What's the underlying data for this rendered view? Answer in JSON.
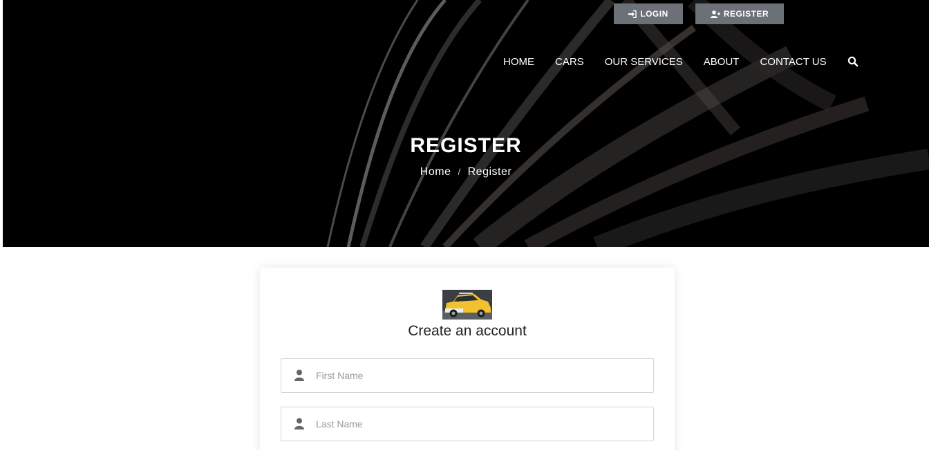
{
  "header": {
    "login_label": "LOGIN",
    "register_label": "REGISTER"
  },
  "nav": {
    "items": [
      {
        "label": "HOME"
      },
      {
        "label": "CARS"
      },
      {
        "label": "OUR SERVICES"
      },
      {
        "label": "ABOUT"
      },
      {
        "label": "CONTACT US"
      }
    ],
    "search_icon": "search-icon"
  },
  "hero": {
    "title": "REGISTER",
    "breadcrumb": {
      "home": "Home",
      "separator": "/",
      "current": "Register"
    }
  },
  "form": {
    "logo_icon": "car-logo",
    "title": "Create an account",
    "fields": [
      {
        "icon": "user-icon",
        "placeholder": "First Name",
        "value": ""
      },
      {
        "icon": "user-icon",
        "placeholder": "Last Name",
        "value": ""
      }
    ]
  },
  "colors": {
    "hero_background": "#000000",
    "top_button": "#6c7178",
    "accent_yellow": "#f2c12e"
  }
}
